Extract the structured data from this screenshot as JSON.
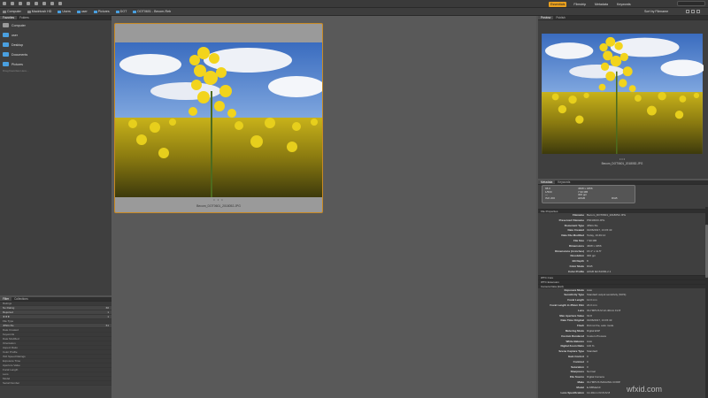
{
  "toolbar": {
    "workspaces": [
      "Essentials",
      "Filmstrip",
      "Metadata",
      "Keywords"
    ],
    "search_placeholder": ""
  },
  "path": [
    {
      "label": "Computer",
      "icon": "computer-icon"
    },
    {
      "label": "Macintosh HD",
      "icon": "drive-icon"
    },
    {
      "label": "Users",
      "icon": "folder-icon"
    },
    {
      "label": "user",
      "icon": "folder-icon"
    },
    {
      "label": "Pictures",
      "icon": "folder-icon"
    },
    {
      "label": "DOT",
      "icon": "folder-icon"
    },
    {
      "label": "DOT0601 - Becom-Reb",
      "icon": "folder-icon"
    }
  ],
  "sort_label": "Sort by Filename",
  "folders_panel": {
    "tabs": [
      "Favorites",
      "Folders"
    ],
    "items": [
      {
        "label": "Computer",
        "icon": "computer-icon",
        "color": "#9a9a9a"
      },
      {
        "label": "user",
        "icon": "user-folder-icon",
        "color": "#4aa0e0"
      },
      {
        "label": "Desktop",
        "icon": "folder-icon",
        "color": "#4aa0e0"
      },
      {
        "label": "Documents",
        "icon": "folder-icon",
        "color": "#4aa0e0"
      },
      {
        "label": "Pictures",
        "icon": "folder-icon",
        "color": "#4aa0e0"
      }
    ],
    "hint": "Drag Favorites Here..."
  },
  "filter_panel": {
    "tabs": [
      "Filter",
      "Collections"
    ],
    "rows": [
      {
        "label": "Ratings",
        "count": "",
        "header": true
      },
      {
        "label": "No Rating",
        "count": "60",
        "header": false
      },
      {
        "label": "Rejected",
        "count": "1",
        "header": false
      },
      {
        "label": "★★★",
        "count": "1",
        "header": false
      },
      {
        "label": "File Type",
        "count": "",
        "header": true
      },
      {
        "label": "JPEG file",
        "count": "61",
        "header": false
      },
      {
        "label": "Date Created",
        "count": "",
        "header": true
      },
      {
        "label": "Keywords",
        "count": "",
        "header": true
      },
      {
        "label": "Date Modified",
        "count": "",
        "header": true
      },
      {
        "label": "Orientation",
        "count": "",
        "header": true
      },
      {
        "label": "Aspect Ratio",
        "count": "",
        "header": true
      },
      {
        "label": "Color Profile",
        "count": "",
        "header": true
      },
      {
        "label": "ISO Speed Ratings",
        "count": "",
        "header": true
      },
      {
        "label": "Exposure Time",
        "count": "",
        "header": true
      },
      {
        "label": "Aperture Value",
        "count": "",
        "header": true
      },
      {
        "label": "Focal Length",
        "count": "",
        "header": true
      },
      {
        "label": "Lens",
        "count": "",
        "header": true
      },
      {
        "label": "Model",
        "count": "",
        "header": true
      },
      {
        "label": "Serial Number",
        "count": "",
        "header": true
      }
    ]
  },
  "content": {
    "thumbnail_label": "Becom_DOT0601_2018052.JPG",
    "thumbnail_dots": "• • •"
  },
  "preview_panel": {
    "tabs": [
      "Preview",
      "Publish"
    ],
    "label": "Becom_DOT0601_2018052.JPG",
    "dots": "• • •"
  },
  "metadata_panel": {
    "tabs": [
      "Metadata",
      "Keywords"
    ],
    "placard": {
      "col1": [
        "f/8.0",
        "1/500",
        "—",
        "ISO 200"
      ],
      "col2": [
        "4608 x 3456",
        "7.90 MB",
        "300 ppi",
        "sRGB"
      ],
      "col3": [
        "",
        "",
        "",
        "RGB"
      ]
    },
    "sections": [
      {
        "title": "File Properties",
        "rows": [
          [
            "Filename",
            "Becom_DOT0601_2018052.JPG"
          ],
          [
            "Preserved Filename",
            "P6010023.JPG"
          ],
          [
            "Document Type",
            "JPEG file"
          ],
          [
            "Date Created",
            "01/06/2017, 13:15:43"
          ],
          [
            "Date File Modified",
            "Today, 19:49:14"
          ],
          [
            "File Size",
            "7.90 MB"
          ],
          [
            "Dimensions",
            "4608 x 3456"
          ],
          [
            "Dimensions (in inches)",
            "15.4\" x 11.5\""
          ],
          [
            "Resolution",
            "300 ppi"
          ],
          [
            "Bit Depth",
            "8"
          ],
          [
            "Color Mode",
            "RGB"
          ],
          [
            "Color Profile",
            "sRGB IEC61966-2.1"
          ]
        ]
      },
      {
        "title": "IPTC Core",
        "rows": []
      },
      {
        "title": "IPTC Extension",
        "rows": []
      },
      {
        "title": "Camera Data (Exif)",
        "rows": [
          [
            "Exposure Mode",
            "Auto"
          ],
          [
            "Sensitivity Type",
            "Standard output sensitivity (SOS)"
          ],
          [
            "Focal Length",
            "12.0 mm"
          ],
          [
            "Focal Length in 35mm Film",
            "24.0 mm"
          ],
          [
            "Lens",
            "OLYMPUS M.12-40mm F2.8"
          ],
          [
            "Max Aperture Value",
            "f/2.8"
          ],
          [
            "Date Time Original",
            "01/06/2017, 13:15:43"
          ],
          [
            "Flash",
            "Did not fire, auto mode"
          ],
          [
            "Metering Mode",
            "Digital ESP"
          ],
          [
            "Custom Rendered",
            "Custom Process"
          ],
          [
            "White Balance",
            "Auto"
          ],
          [
            "Digital Zoom Ratio",
            "100 %"
          ],
          [
            "Scene Capture Type",
            "Standard"
          ],
          [
            "Gain Control",
            "0"
          ],
          [
            "Contrast",
            "0"
          ],
          [
            "Saturation",
            "0"
          ],
          [
            "Sharpness",
            "Normal"
          ],
          [
            "File Source",
            "Digital Camera"
          ],
          [
            "Make",
            "OLYMPUS IMAGING CORP."
          ],
          [
            "Model",
            "E-M5MarkII"
          ],
          [
            "Lens Specification",
            "12-40mm f/2.8-f/2.8"
          ]
        ]
      }
    ]
  },
  "watermark": "wfxid.com"
}
